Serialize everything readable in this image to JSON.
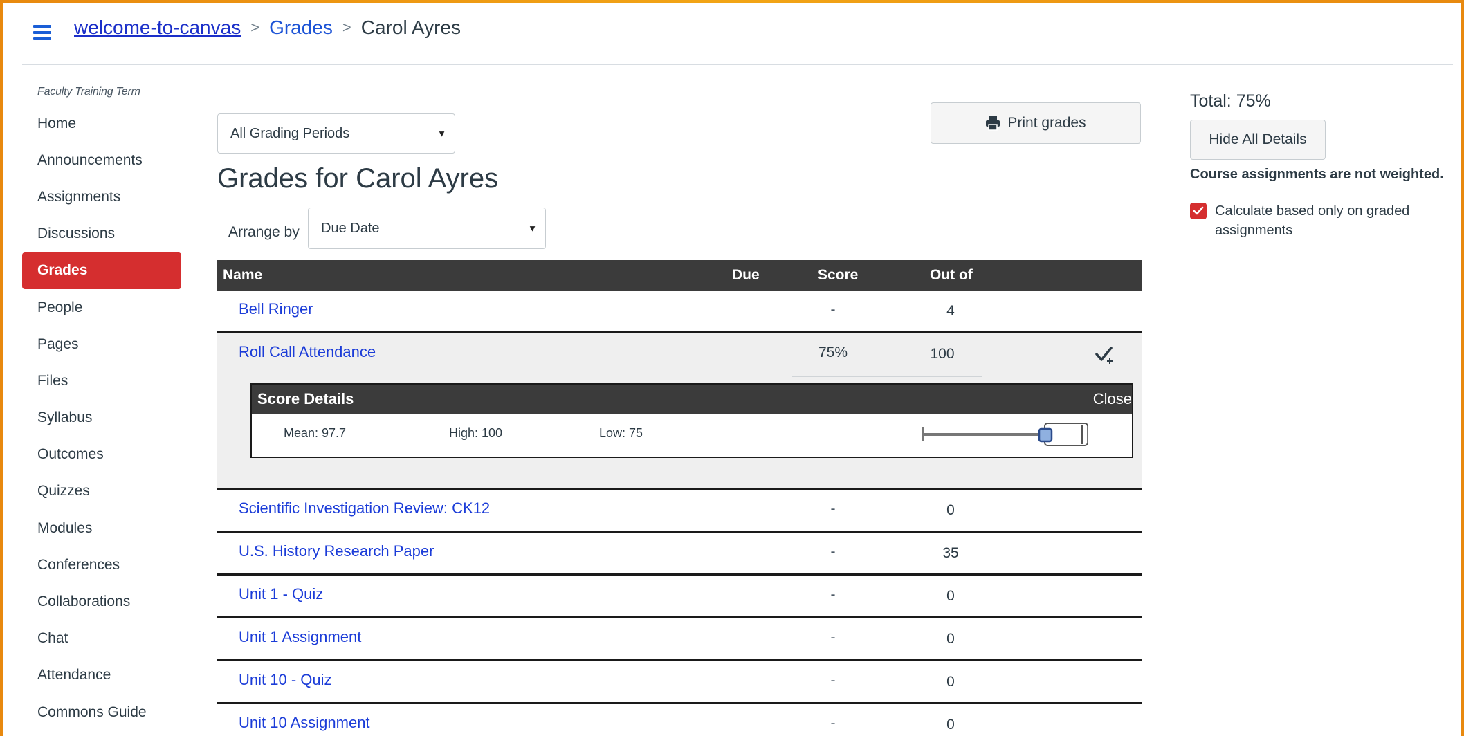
{
  "breadcrumb": {
    "course": "welcome-to-canvas",
    "section": "Grades",
    "student": "Carol Ayres"
  },
  "sidebar": {
    "term": "Faculty Training Term",
    "items": [
      {
        "label": "Home"
      },
      {
        "label": "Announcements"
      },
      {
        "label": "Assignments"
      },
      {
        "label": "Discussions"
      },
      {
        "label": "Grades",
        "active": true
      },
      {
        "label": "People"
      },
      {
        "label": "Pages"
      },
      {
        "label": "Files"
      },
      {
        "label": "Syllabus"
      },
      {
        "label": "Outcomes"
      },
      {
        "label": "Quizzes"
      },
      {
        "label": "Modules"
      },
      {
        "label": "Conferences"
      },
      {
        "label": "Collaborations"
      },
      {
        "label": "Chat"
      },
      {
        "label": "Attendance"
      },
      {
        "label": "Commons Guide"
      }
    ]
  },
  "filters": {
    "grading_period": "All Grading Periods",
    "arrange_label": "Arrange by",
    "arrange_value": "Due Date"
  },
  "print_label": "Print grades",
  "page_title": "Grades for Carol Ayres",
  "table": {
    "headers": {
      "name": "Name",
      "due": "Due",
      "score": "Score",
      "out_of": "Out of"
    },
    "rows": [
      {
        "name": "Bell Ringer",
        "score": "-",
        "out_of": "4"
      },
      {
        "name": "Roll Call Attendance",
        "score": "75%",
        "out_of": "100"
      },
      {
        "name": "Scientific Investigation Review: CK12",
        "score": "-",
        "out_of": "0"
      },
      {
        "name": "U.S. History Research Paper",
        "score": "-",
        "out_of": "35"
      },
      {
        "name": "Unit 1 - Quiz",
        "score": "-",
        "out_of": "0"
      },
      {
        "name": "Unit 1 Assignment",
        "score": "-",
        "out_of": "0"
      },
      {
        "name": "Unit 10 - Quiz",
        "score": "-",
        "out_of": "0"
      },
      {
        "name": "Unit 10 Assignment",
        "score": "-",
        "out_of": "0"
      }
    ]
  },
  "score_details": {
    "title": "Score Details",
    "close": "Close",
    "mean": "Mean: 97.7",
    "high": "High: 100",
    "low": "Low: 75"
  },
  "right_panel": {
    "total": "Total: 75%",
    "hide_details": "Hide All Details",
    "weight_note": "Course assignments are not weighted.",
    "calc_label": "Calculate based only on graded assignments",
    "calc_checked": true
  },
  "colors": {
    "accent": "#d52e2f",
    "link": "#1b3cd8",
    "header_dark": "#3b3b3b"
  }
}
